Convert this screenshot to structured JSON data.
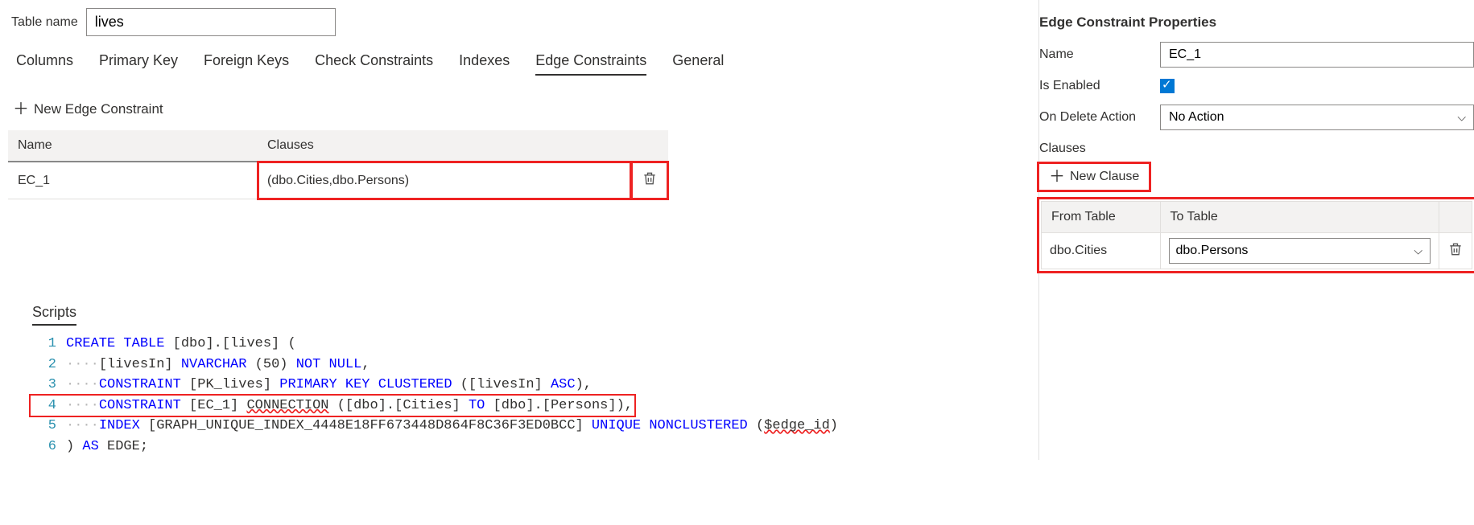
{
  "tableName": {
    "label": "Table name",
    "value": "lives"
  },
  "tabs": [
    "Columns",
    "Primary Key",
    "Foreign Keys",
    "Check Constraints",
    "Indexes",
    "Edge Constraints",
    "General"
  ],
  "activeTab": "Edge Constraints",
  "addConstraintLabel": "New Edge Constraint",
  "constraintTable": {
    "headers": {
      "name": "Name",
      "clauses": "Clauses"
    },
    "rows": [
      {
        "name": "EC_1",
        "clauses": "(dbo.Cities,dbo.Persons)"
      }
    ]
  },
  "scripts": {
    "label": "Scripts"
  },
  "properties": {
    "title": "Edge Constraint Properties",
    "nameLabel": "Name",
    "nameValue": "EC_1",
    "isEnabledLabel": "Is Enabled",
    "isEnabled": true,
    "onDeleteLabel": "On Delete Action",
    "onDeleteValue": "No Action",
    "clausesLabel": "Clauses",
    "newClauseLabel": "New Clause",
    "clauseHeaders": {
      "from": "From Table",
      "to": "To Table"
    },
    "clauseRows": [
      {
        "from": "dbo.Cities",
        "to": "dbo.Persons"
      }
    ]
  }
}
